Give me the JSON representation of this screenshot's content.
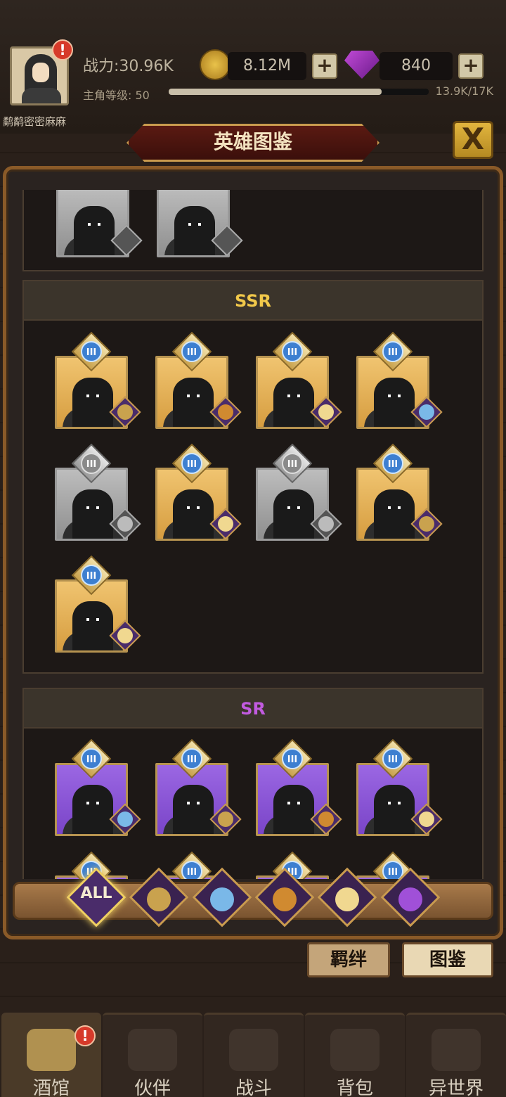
{
  "player": {
    "name": "鹬鹬密密麻麻",
    "power_label": "战力:30.96K",
    "level_label": "主角等级: 50",
    "xp_text": "13.9K/17K",
    "xp_progress": 0.82
  },
  "resources": {
    "gold": "8.12M",
    "gems": "840",
    "plus": "+"
  },
  "alert_mark": "!",
  "title": "英雄图鉴",
  "close_label": "X",
  "sections": {
    "ssr": "SSR",
    "sr": "SR"
  },
  "rank_label": "III",
  "filters": {
    "all": "ALL"
  },
  "subtabs": {
    "bonds": "羁绊",
    "codex": "图鉴"
  },
  "nav": [
    "酒馆",
    "伙伴",
    "战斗",
    "背包",
    "异世界"
  ],
  "colors": {
    "ssr": "#f1c84a",
    "sr": "#c25be0",
    "gold_card": "#e8b655",
    "purple_card": "#8a55d6"
  },
  "icons": [
    "coin-icon",
    "gem-icon",
    "close-icon",
    "rank-badge-icon",
    "faction-icon",
    "beer-mug-icon",
    "partner-icon",
    "crossed-swords-icon",
    "backpack-icon",
    "portal-icon"
  ]
}
